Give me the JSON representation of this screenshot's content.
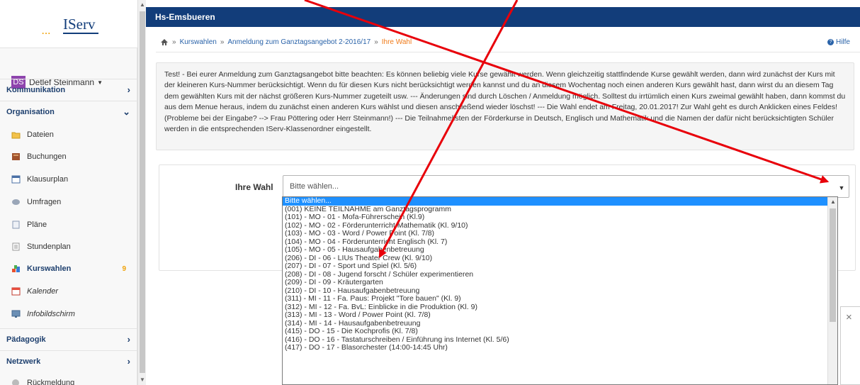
{
  "app": {
    "logo_text": "IServ",
    "school_title": "Hs-Emsbueren"
  },
  "user": {
    "initials": "DS",
    "name": "Detlef Steinmann"
  },
  "sidebar": {
    "sections": {
      "kommunikation": "Kommunikation",
      "organisation": "Organisation",
      "paedagogik": "Pädagogik",
      "netzwerk": "Netzwerk"
    },
    "items": [
      {
        "label": "Dateien",
        "icon": "folder-icon"
      },
      {
        "label": "Buchungen",
        "icon": "booking-icon"
      },
      {
        "label": "Klausurplan",
        "icon": "calendar-icon"
      },
      {
        "label": "Umfragen",
        "icon": "survey-icon"
      },
      {
        "label": "Pläne",
        "icon": "plan-icon"
      },
      {
        "label": "Stundenplan",
        "icon": "timetable-icon"
      },
      {
        "label": "Kurswahlen",
        "icon": "course-icon",
        "badge": "9"
      },
      {
        "label": "Kalender",
        "icon": "calendar-icon"
      },
      {
        "label": "Infobildschirm",
        "icon": "monitor-icon"
      }
    ],
    "bottom_item": "Rückmeldung"
  },
  "breadcrumb": {
    "items": [
      "Kurswahlen",
      "Anmeldung zum Ganztagsangebot 2-2016/17"
    ],
    "current": "Ihre Wahl",
    "separator": "»"
  },
  "help": "Hilfe",
  "info_text": "Test! - Bei eurer Anmeldung zum Ganztagsangebot bitte beachten: Es können beliebig viele Kurse gewählt werden. Wenn gleichzeitig stattfindende Kurse gewählt werden, dann wird zunächst der Kurs mit der kleineren Kurs-Nummer berücksichtigt. Wenn du für diesen Kurs nicht berücksichtigt werden kannst und du an diesem Wochentag noch einen anderen Kurs gewählt hast, dann wirst du an diesem Tag dem gewählten Kurs mit der nächst größeren Kurs-Nummer zugeteilt usw. --- Änderungen sind durch Löschen / Anmeldung möglich. Solltest du irrtümlich einen Kurs zweimal gewählt haben, dann kommst du aus dem Menue heraus, indem du zunächst einen anderen Kurs wählst und diesen anschließend wieder löschst! --- Die Wahl endet am Freitag, 20.01.2017! Zur Wahl geht es durch Anklicken eines Feldes! (Probleme bei der Eingabe? --> Frau Pöttering oder Herr Steinmann!) --- Die Teilnahmelisten der Förderkurse in Deutsch, Englisch und Mathematik und die Namen der dafür nicht berücksichtigten Schüler werden in die entsprechenden IServ-Klassenordner eingestellt.",
  "form": {
    "label": "Ihre Wahl",
    "select_value": "Bitte wählen...",
    "options": [
      "Bitte wählen...",
      "(001) KEINE TEILNAHME am Ganztagsprogramm",
      "(101) - MO - 01 - Mofa-Führerschein (Kl.9)",
      "(102) - MO - 02 - Förderunterricht Mathematik (Kl. 9/10)",
      "(103) - MO - 03 - Word / Power Point (Kl. 7/8)",
      "(104) - MO - 04 - Förderunterricht Englisch (Kl. 7)",
      "(105) - MO - 05 - Hausaufgabenbetreuung",
      "(206) - DI - 06 - LIUs Theater Crew (Kl. 9/10)",
      "(207) - DI - 07 - Sport und Spiel (Kl. 5/6)",
      "(208) - DI - 08 - Jugend forscht / Schüler experimentieren",
      "(209) - DI - 09 - Kräutergarten",
      "(210) - DI - 10 - Hausaufgabenbetreuung",
      "(311) - MI - 11 - Fa. Paus: Projekt \"Tore bauen\" (Kl. 9)",
      "(312) - MI - 12 - Fa. BvL: Einblicke in die Produktion (Kl. 9)",
      "(313) - MI - 13 - Word / Power Point (Kl. 7/8)",
      "(314) - MI - 14 - Hausaufgabenbetreuung",
      "(415) - DO - 15 - Die Kochprofis (Kl. 7/8)",
      "(416) - DO - 16 - Tastaturschreiben / Einführung ins Internet (Kl. 5/6)",
      "(417) - DO - 17 - Blasorchester (14:00-14:45 Uhr)"
    ]
  },
  "colors": {
    "header": "#123d7a",
    "accent": "#f07b1a",
    "selection": "#1e90ff",
    "annotation": "#e8000a"
  }
}
